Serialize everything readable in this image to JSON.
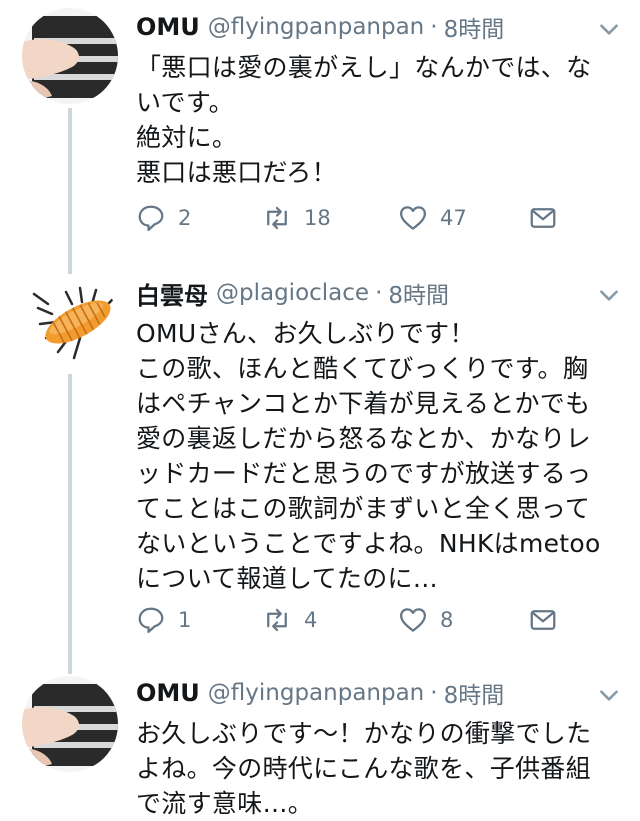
{
  "tweets": [
    {
      "name": "OMU",
      "handle": "@flyingpanpanpan",
      "time": "8時間",
      "lines": [
        "「悪口は愛の裏がえし」なんかでは、な",
        "いです。",
        "絶対に。",
        "悪口は悪口だろ！"
      ],
      "reply_count": "2",
      "retweet_count": "18",
      "like_count": "47"
    },
    {
      "name": "白雲母",
      "handle": "@plagioclace",
      "time": "8時間",
      "lines": [
        "OMUさん、お久しぶりです！",
        "この歌、ほんと酷くてびっくりです。胸",
        "はペチャンコとか下着が見えるとかでも",
        "愛の裏返しだから怒るなとか、かなりレ",
        "ッドカードだと思うのですが放送するっ",
        "てことはこの歌詞がまずいと全く思って",
        "ないということですよね。NHKはmetoo",
        "について報道してたのに…"
      ],
      "reply_count": "1",
      "retweet_count": "4",
      "like_count": "8"
    },
    {
      "name": "OMU",
      "handle": "@flyingpanpanpan",
      "time": "8時間",
      "lines": [
        "お久しぶりです〜！かなりの衝撃でした",
        "よね。今の時代にこんな歌を、子供番組",
        "で流す意味…。"
      ]
    }
  ],
  "icons": {
    "reply": "reply-icon",
    "retweet": "retweet-icon",
    "like": "heart-icon",
    "dm": "envelope-icon",
    "caret": "chevron-down-icon"
  },
  "colors": {
    "secondary_text": "#657786",
    "thread_line": "#ccd6dd"
  }
}
